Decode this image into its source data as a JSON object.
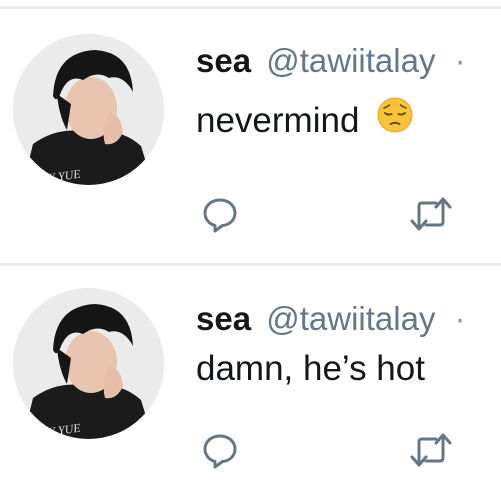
{
  "tweets": [
    {
      "name": "sea",
      "handle": "@tawiitalay",
      "separator": "·",
      "text": "nevermind",
      "emoji": "pensive-face-icon",
      "actions": [
        "reply-icon",
        "retweet-icon"
      ]
    },
    {
      "name": "sea",
      "handle": "@tawiitalay",
      "separator": "·",
      "text": "damn, he’s hot",
      "emoji": "",
      "actions": [
        "reply-icon",
        "retweet-icon"
      ]
    }
  ],
  "colors": {
    "name": "#14171a",
    "handle": "#657786",
    "icons": "#657786",
    "divider": "#e6ecf0"
  }
}
